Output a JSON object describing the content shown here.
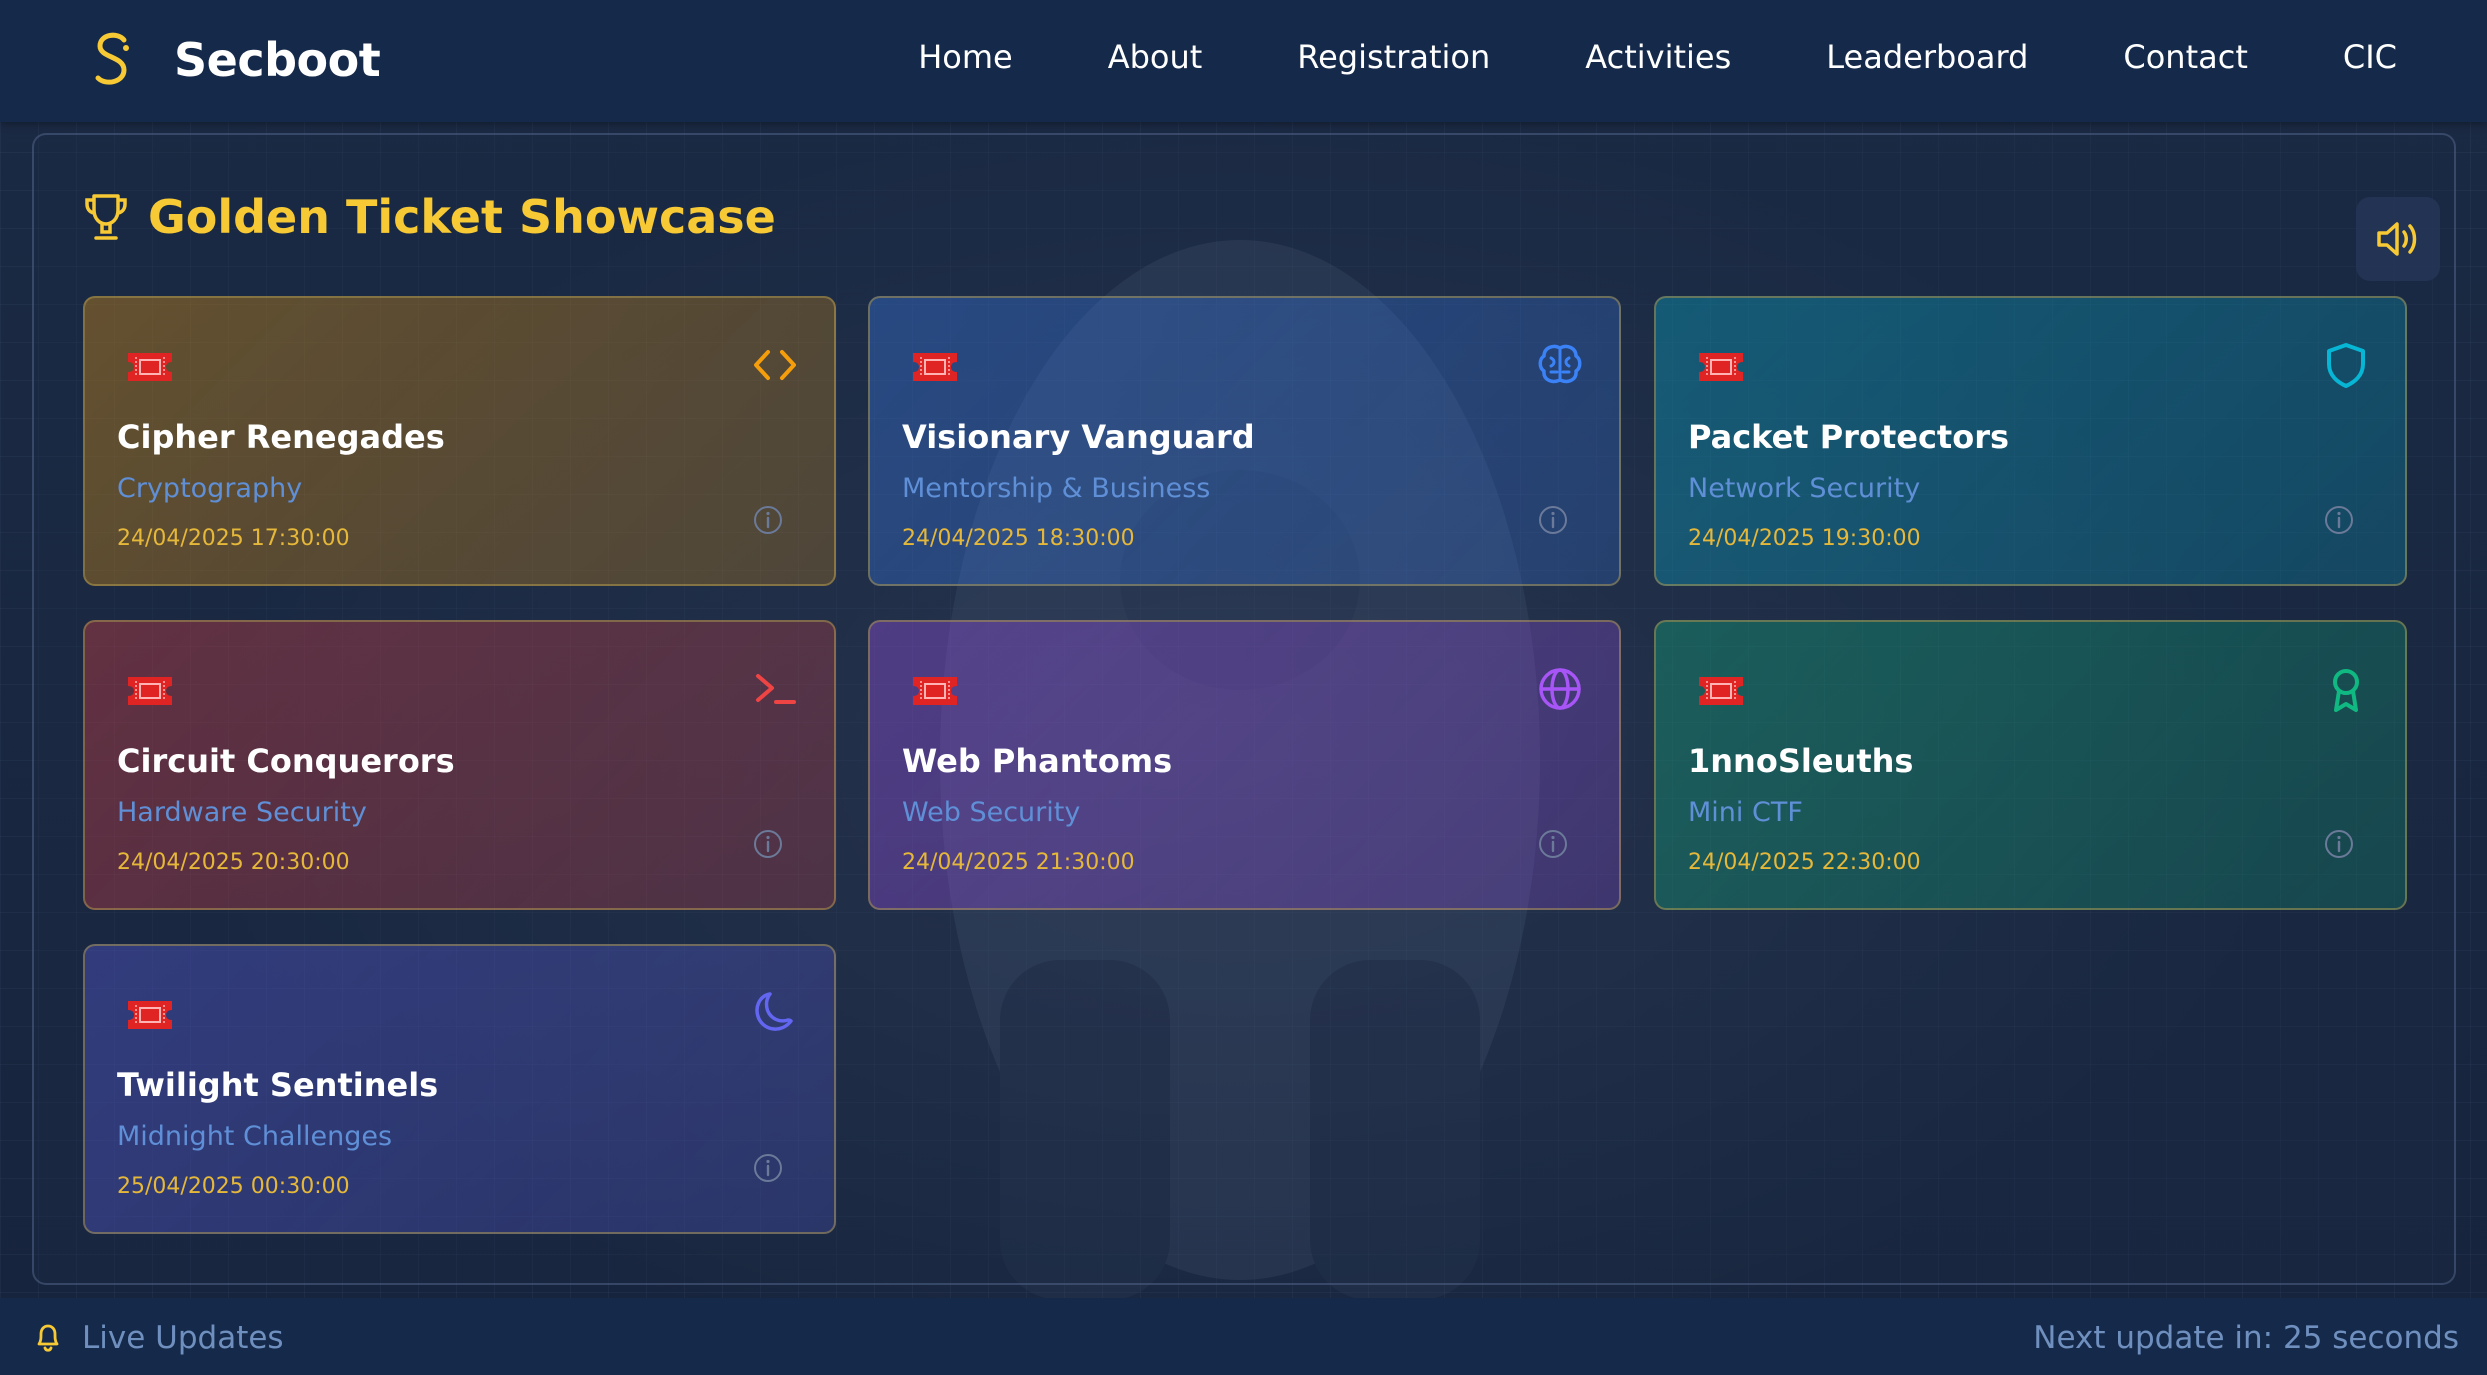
{
  "brand": {
    "name": "Secboot",
    "logo_icon": "s-logo-icon"
  },
  "nav": {
    "items": [
      "Home",
      "About",
      "Registration",
      "Activities",
      "Leaderboard",
      "Contact",
      "CIC"
    ]
  },
  "showcase": {
    "title": "Golden Ticket Showcase",
    "title_icon": "trophy-icon",
    "sound_icon": "volume-icon",
    "accent": "#f6c935"
  },
  "cards": [
    {
      "name": "Cipher Renegades",
      "category": "Cryptography",
      "time": "24/04/2025 17:30:00",
      "icon": "code-icon",
      "color": "#f59e0b"
    },
    {
      "name": "Visionary Vanguard",
      "category": "Mentorship & Business",
      "time": "24/04/2025 18:30:00",
      "icon": "brain-icon",
      "color": "#3b82f6"
    },
    {
      "name": "Packet Protectors",
      "category": "Network Security",
      "time": "24/04/2025 19:30:00",
      "icon": "shield-icon",
      "color": "#06b6d4"
    },
    {
      "name": "Circuit Conquerors",
      "category": "Hardware Security",
      "time": "24/04/2025 20:30:00",
      "icon": "terminal-icon",
      "color": "#ef4444"
    },
    {
      "name": "Web Phantoms",
      "category": "Web Security",
      "time": "24/04/2025 21:30:00",
      "icon": "globe-icon",
      "color": "#a855f7"
    },
    {
      "name": "1nnoSleuths",
      "category": "Mini CTF",
      "time": "24/04/2025 22:30:00",
      "icon": "award-icon",
      "color": "#10b981"
    },
    {
      "name": "Twilight Sentinels",
      "category": "Midnight Challenges",
      "time": "25/04/2025 00:30:00",
      "icon": "moon-icon",
      "color": "#6366f1"
    }
  ],
  "footer": {
    "live_label": "Live Updates",
    "next_update": "Next update in: 25 seconds"
  }
}
